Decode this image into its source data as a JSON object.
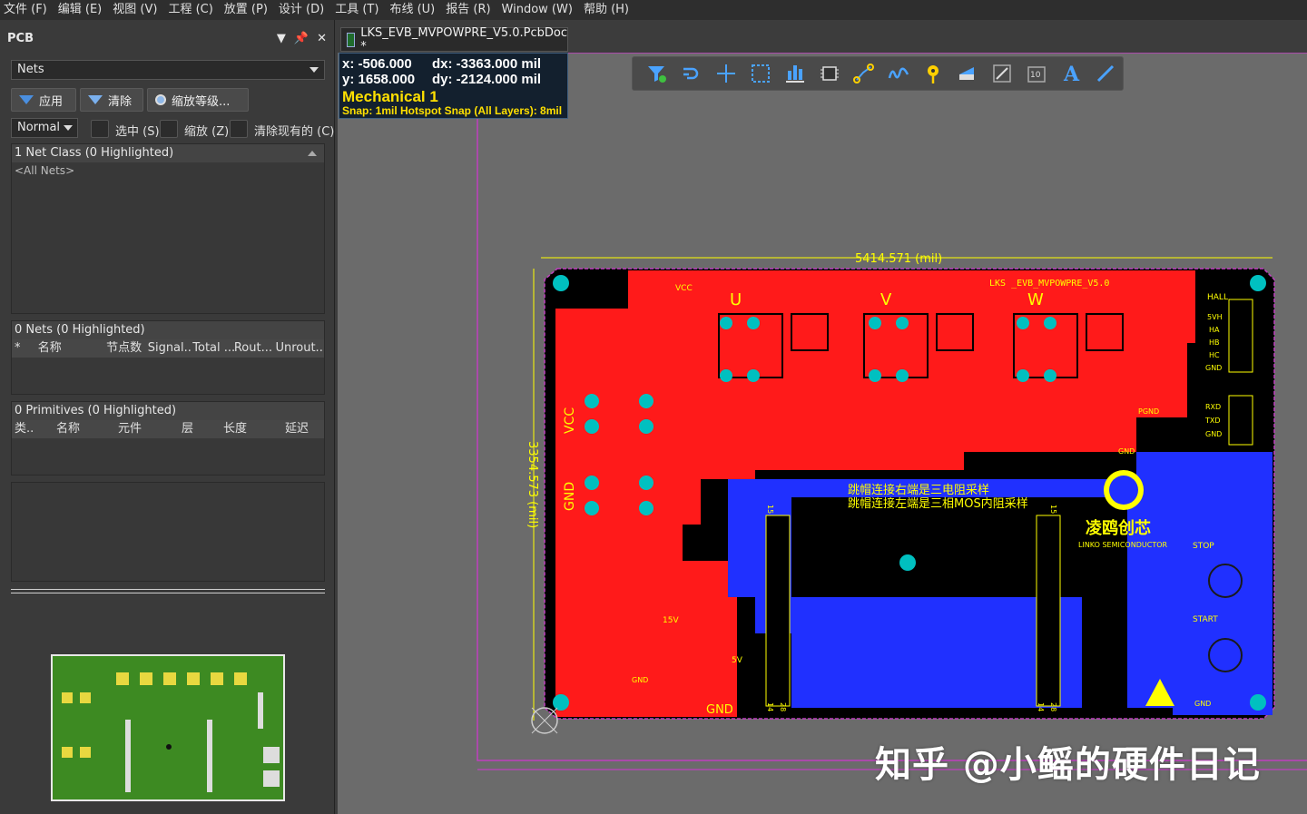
{
  "menu": [
    "文件 (F)",
    "编辑 (E)",
    "视图 (V)",
    "工程 (C)",
    "放置 (P)",
    "设计 (D)",
    "工具 (T)",
    "布线 (U)",
    "报告 (R)",
    "Window (W)",
    "帮助 (H)"
  ],
  "panel": {
    "title": "PCB",
    "mode_select": "Nets",
    "buttons": {
      "apply": "应用",
      "clear": "清除",
      "zoom_level": "缩放等级..."
    },
    "highlight_mode": "Normal",
    "checks": {
      "select": "选中 (S)",
      "zoom": "缩放 (Z)",
      "clear_existing": "清除现有的 (C)"
    },
    "net_class": {
      "title": "1 Net Class (0 Highlighted)",
      "item": "<All Nets>"
    },
    "nets": {
      "title": "0 Nets (0 Highlighted)",
      "columns": [
        "*",
        "名称",
        "节点数",
        "Signal...",
        "Total ...",
        "Rout...",
        "Unrout..."
      ]
    },
    "primitives": {
      "title": "0 Primitives (0 Highlighted)",
      "columns": [
        "类..",
        "名称",
        "元件",
        "层",
        "长度",
        "延迟"
      ]
    }
  },
  "document": {
    "tab": "LKS_EVB_MVPOWPRE_V5.0.PcbDoc *"
  },
  "coords": {
    "x": "x:  -506.000",
    "dx": "dx: -3363.000 mil",
    "y": "y:  1658.000",
    "dy": "dy: -2124.000 mil",
    "layer": "Mechanical 1",
    "snap": "Snap: 1mil Hotspot Snap (All Layers): 8mil"
  },
  "toolbar_icons": [
    "filter-icon",
    "route-icon",
    "cross-icon",
    "select-rect-icon",
    "align-icon",
    "component-icon",
    "connection-icon",
    "interactive-route-icon",
    "pad-icon",
    "fill-icon",
    "region-icon",
    "string-icon",
    "text-icon",
    "line-icon"
  ],
  "board": {
    "width_dim": "5414.571 (mil)",
    "height_dim": "3354.573 (mil)",
    "title": "LKS _EVB_MVPOWPRE_V5.0",
    "vcc": "VCC",
    "phase_labels": [
      "U",
      "V",
      "W"
    ],
    "left_labels": [
      "VCC",
      "GND"
    ],
    "hall": "HALL",
    "hall_pins": [
      "5VH",
      "HA",
      "HB",
      "HC",
      "GND"
    ],
    "uart_pins": [
      "RXD",
      "TXD",
      "GND"
    ],
    "pgnd": "PGND",
    "gnd": "GND",
    "note_line1": "跳帽连接右端是三电阻采样",
    "note_line2": "跳帽连接左端是三相MOS内阻采样",
    "logo_cn": "凌鸥创芯",
    "logo_en": "LINKO SEMICONDUCTOR",
    "stop": "STOP",
    "start": "START",
    "v15": "15V",
    "v5": "5V",
    "gnd_bottom": "GND",
    "gnd_right": "GND",
    "header_nums": [
      "15",
      "14",
      "28",
      "15",
      "14",
      "28"
    ]
  },
  "watermark": "知乎 @小鳐的硬件日记",
  "colors": {
    "top_layer": "#ff1a1a",
    "bottom_layer": "#2030ff",
    "silk": "#ffff00",
    "keepout": "#c040c0",
    "board_bg": "#000000",
    "minimap": "#3d8a22"
  }
}
